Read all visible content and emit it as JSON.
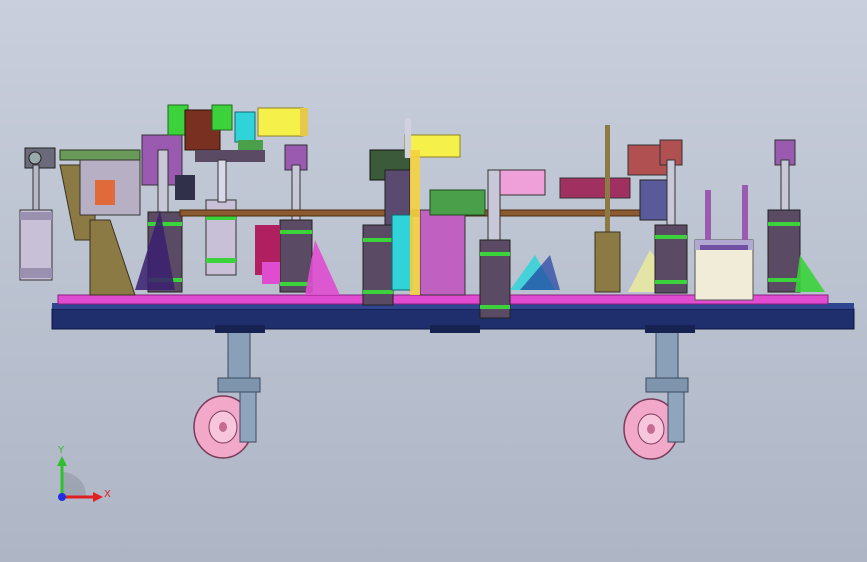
{
  "viewport": {
    "background_top": "#c9cfdc",
    "background_bottom": "#aeb6c6"
  },
  "model": {
    "frame_color": "#1f2f6e",
    "plate_color": "#e04cd0",
    "wheel_color": "#f2a8c8",
    "cylinder_color": "#5b4a63",
    "bracket_olive": "#8c7a45",
    "accent_green": "#3bd23b",
    "accent_yellow": "#f5f04a",
    "accent_cyan": "#2fd3d8"
  },
  "triad": {
    "x_label": "X",
    "y_label": "Y",
    "x_color": "#e02020",
    "y_color": "#2fbf2f",
    "z_color": "#2030e0"
  }
}
